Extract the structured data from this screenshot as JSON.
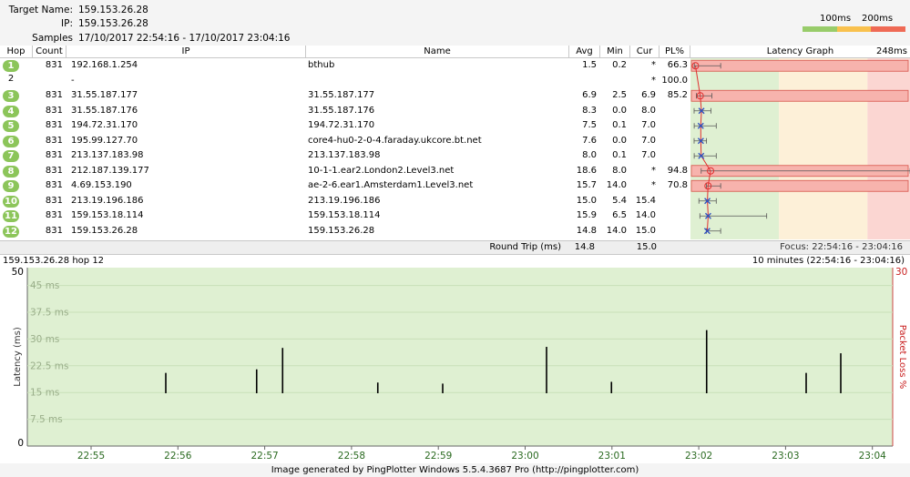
{
  "header": {
    "target_name_label": "Target Name:",
    "target_name": "159.153.26.28",
    "ip_label": "IP:",
    "ip": "159.153.26.28",
    "samples_label": "Samples Timed:",
    "samples": "17/10/2017 22:54:16 - 17/10/2017 23:04:16",
    "scale_100": "100ms",
    "scale_200": "200ms",
    "scale_colors": [
      "#98cc6a",
      "#f9c14e",
      "#ef6a55"
    ]
  },
  "table": {
    "columns": {
      "hop": "Hop",
      "count": "Count",
      "ip": "IP",
      "name": "Name",
      "avg": "Avg",
      "min": "Min",
      "cur": "Cur",
      "pl": "PL%",
      "graph": "Latency Graph",
      "graph_max": "248ms"
    },
    "graph_max_ms": 248,
    "rows": [
      {
        "hop": "1",
        "count": "831",
        "ip": "192.168.1.254",
        "name": "bthub",
        "avg": "1.5",
        "min": "0.2",
        "cur": "*",
        "pl": "66.3",
        "loss": true,
        "circled": true,
        "avg_ms": 1.5,
        "min_ms": 0.2,
        "max_ms": 30
      },
      {
        "hop": "2",
        "count": "",
        "ip": "-",
        "name": "",
        "avg": "",
        "min": "",
        "cur": "*",
        "pl": "100.0",
        "loss": false,
        "circled": false,
        "avg_ms": null
      },
      {
        "hop": "3",
        "count": "831",
        "ip": "31.55.187.177",
        "name": "31.55.187.177",
        "avg": "6.9",
        "min": "2.5",
        "cur": "6.9",
        "pl": "85.2",
        "loss": true,
        "circled": true,
        "avg_ms": 6.9,
        "min_ms": 2.5,
        "max_ms": 20
      },
      {
        "hop": "4",
        "count": "831",
        "ip": "31.55.187.176",
        "name": "31.55.187.176",
        "avg": "8.3",
        "min": "0.0",
        "cur": "8.0",
        "pl": "",
        "loss": false,
        "circled": true,
        "avg_ms": 8.3,
        "min_ms": 0,
        "max_ms": 19
      },
      {
        "hop": "5",
        "count": "831",
        "ip": "194.72.31.170",
        "name": "194.72.31.170",
        "avg": "7.5",
        "min": "0.1",
        "cur": "7.0",
        "pl": "",
        "loss": false,
        "circled": true,
        "avg_ms": 7.5,
        "min_ms": 0.1,
        "max_ms": 25
      },
      {
        "hop": "6",
        "count": "831",
        "ip": "195.99.127.70",
        "name": "core4-hu0-2-0-4.faraday.ukcore.bt.net",
        "avg": "7.6",
        "min": "0.0",
        "cur": "7.0",
        "pl": "",
        "loss": false,
        "circled": true,
        "avg_ms": 7.6,
        "min_ms": 0,
        "max_ms": 14
      },
      {
        "hop": "7",
        "count": "831",
        "ip": "213.137.183.98",
        "name": "213.137.183.98",
        "avg": "8.0",
        "min": "0.1",
        "cur": "7.0",
        "pl": "",
        "loss": false,
        "circled": true,
        "avg_ms": 8.0,
        "min_ms": 0.1,
        "max_ms": 25
      },
      {
        "hop": "8",
        "count": "831",
        "ip": "212.187.139.177",
        "name": "10-1-1.ear2.London2.Level3.net",
        "avg": "18.6",
        "min": "8.0",
        "cur": "*",
        "pl": "94.8",
        "loss": true,
        "circled": true,
        "avg_ms": 18.6,
        "min_ms": 8,
        "max_ms": 244
      },
      {
        "hop": "9",
        "count": "831",
        "ip": "4.69.153.190",
        "name": "ae-2-6.ear1.Amsterdam1.Level3.net",
        "avg": "15.7",
        "min": "14.0",
        "cur": "*",
        "pl": "70.8",
        "loss": true,
        "circled": true,
        "avg_ms": 15.7,
        "min_ms": 14,
        "max_ms": 30
      },
      {
        "hop": "10",
        "count": "831",
        "ip": "213.19.196.186",
        "name": "213.19.196.186",
        "avg": "15.0",
        "min": "5.4",
        "cur": "15.4",
        "pl": "",
        "loss": false,
        "circled": true,
        "avg_ms": 15.0,
        "min_ms": 5.4,
        "max_ms": 25
      },
      {
        "hop": "11",
        "count": "831",
        "ip": "159.153.18.114",
        "name": "159.153.18.114",
        "avg": "15.9",
        "min": "6.5",
        "cur": "14.0",
        "pl": "",
        "loss": false,
        "circled": true,
        "avg_ms": 15.9,
        "min_ms": 6.5,
        "max_ms": 82
      },
      {
        "hop": "12",
        "count": "831",
        "ip": "159.153.26.28",
        "name": "159.153.26.28",
        "avg": "14.8",
        "min": "14.0",
        "cur": "15.0",
        "pl": "",
        "loss": false,
        "circled": true,
        "avg_ms": 14.8,
        "min_ms": 14,
        "max_ms": 30
      }
    ],
    "round_trip_label": "Round Trip (ms)",
    "round_trip_avg": "14.8",
    "round_trip_cur": "15.0",
    "focus": "Focus: 22:54:16 - 23:04:16",
    "graph_zone_colors": [
      "#dff0d2",
      "#fdf0d8",
      "#fbd6d2"
    ]
  },
  "chart_data": {
    "type": "line",
    "title_left": "159.153.26.28 hop 12",
    "title_right": "10 minutes (22:54:16 - 23:04:16)",
    "ylabel": "Latency (ms)",
    "y2label": "Packet Loss %",
    "ylim": [
      0,
      50
    ],
    "y2_max": "30",
    "y_ticks": [
      {
        "v": 0,
        "label": "0"
      },
      {
        "v": 7.5,
        "label": "7.5 ms"
      },
      {
        "v": 15,
        "label": "15 ms"
      },
      {
        "v": 22.5,
        "label": "22.5 ms"
      },
      {
        "v": 30,
        "label": "30 ms"
      },
      {
        "v": 37.5,
        "label": "37.5 ms"
      },
      {
        "v": 45,
        "label": "45 ms"
      },
      {
        "v": 50,
        "label": "50"
      }
    ],
    "x_labels": [
      "22:55",
      "22:56",
      "22:57",
      "22:58",
      "22:59",
      "23:00",
      "23:01",
      "23:02",
      "23:03",
      "23:04"
    ],
    "baseline_ms": 14.8,
    "spikes": [
      {
        "t": 0.16,
        "v": 20.5
      },
      {
        "t": 0.265,
        "v": 21.5
      },
      {
        "t": 0.295,
        "v": 27.5
      },
      {
        "t": 0.405,
        "v": 17.8
      },
      {
        "t": 0.48,
        "v": 17.5
      },
      {
        "t": 0.6,
        "v": 27.8
      },
      {
        "t": 0.675,
        "v": 18.0
      },
      {
        "t": 0.785,
        "v": 32.5
      },
      {
        "t": 0.9,
        "v": 20.5
      },
      {
        "t": 0.94,
        "v": 26.0
      }
    ],
    "bg_color": "#dff0d2",
    "loss_color": "#c81e1e"
  },
  "footer": "Image generated by PingPlotter Windows 5.5.4.3687 Pro (http://pingplotter.com)"
}
